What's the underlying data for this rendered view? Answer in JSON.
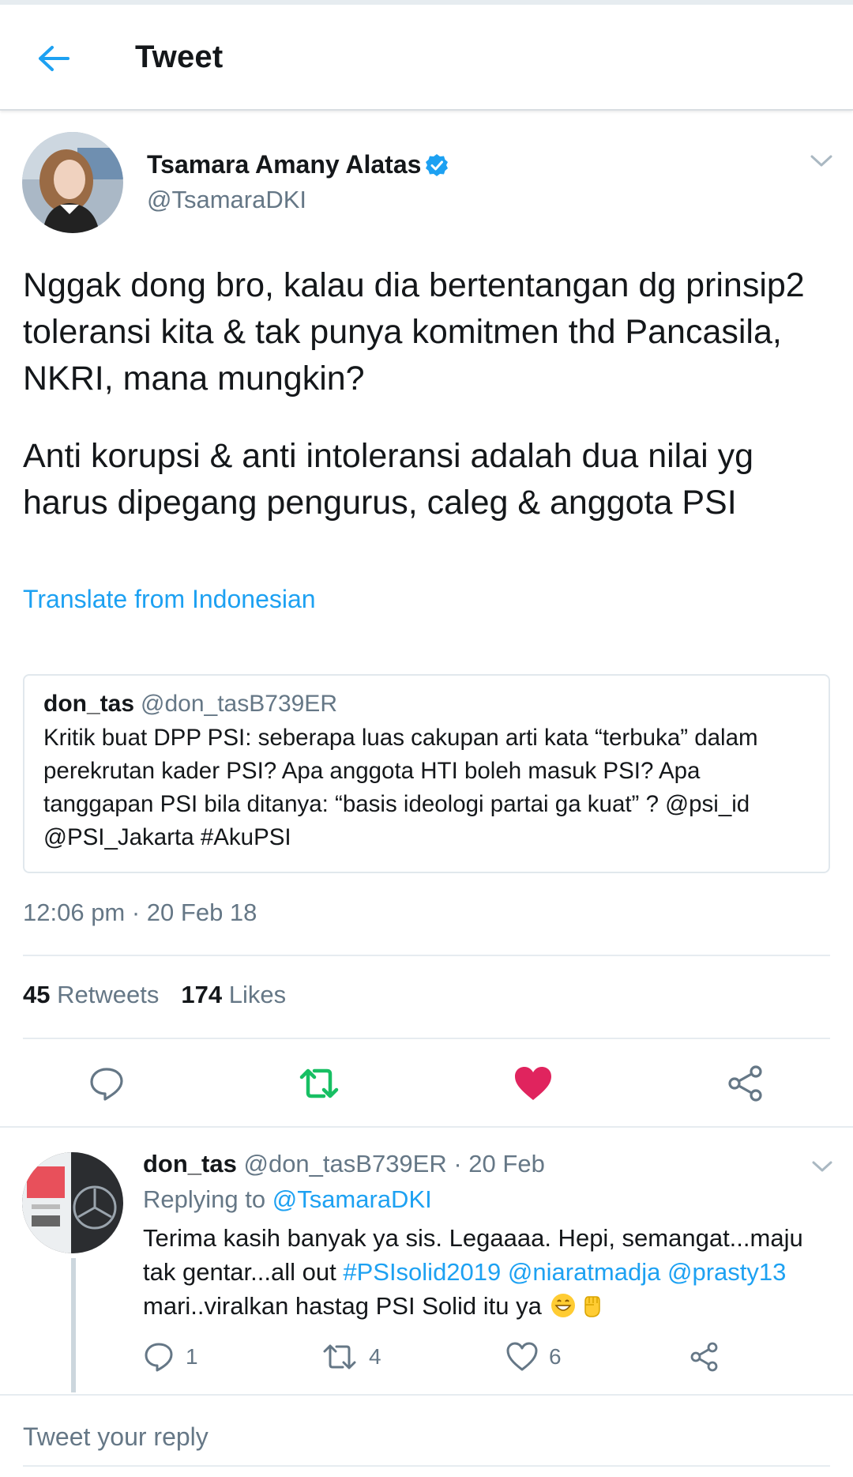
{
  "header": {
    "title": "Tweet",
    "back_icon": "arrow-left-icon",
    "accent_color": "#1da1f2"
  },
  "tweet": {
    "author_name": "Tsamara Amany Alatas",
    "author_handle": "@TsamaraDKI",
    "verified": true,
    "paragraph_1": "Nggak dong bro, kalau dia bertentangan dg prinsip2 toleransi kita & tak punya komitmen thd Pancasila, NKRI, mana mungkin?",
    "paragraph_2": "Anti korupsi & anti intoleransi adalah dua nilai yg harus dipegang pengurus, caleg & anggota PSI",
    "translate_label": "Translate from Indonesian",
    "timestamp": "12:06 pm · 20 Feb 18",
    "retweet_count": "45",
    "retweet_label": "Retweets",
    "like_count": "174",
    "like_label": "Likes",
    "liked": true,
    "liked_color": "#e0245e",
    "retweeted": true,
    "retweeted_color": "#17bf63"
  },
  "quote": {
    "name": "don_tas",
    "handle": "@don_tasB739ER",
    "text": "Kritik buat DPP PSI: seberapa luas cakupan arti kata “terbuka” dalam perekrutan kader PSI? Apa anggota HTI boleh masuk PSI? Apa tanggapan PSI bila ditanya: “basis ideologi partai ga kuat” ? @psi_id @PSI_Jakarta #AkuPSI"
  },
  "reply": {
    "name": "don_tas",
    "handle": "@don_tasB739ER",
    "date": "· 20 Feb",
    "replying_prefix": "Replying to",
    "replying_to": "@TsamaraDKI",
    "text_before": "Terima kasih banyak ya sis. Legaaaa. Hepi, semangat...maju tak gentar...all out",
    "hashtag": "#PSIsolid2019",
    "mention_1": "@niaratmadja",
    "mention_2": "@prasty13",
    "text_after": "mari..viralkan hastag PSI Solid itu ya",
    "emojis": [
      "grinning-face-icon",
      "raised-fist-icon"
    ],
    "reply_count": "1",
    "retweet_count": "4",
    "like_count": "6"
  },
  "compose": {
    "placeholder": "Tweet your reply"
  }
}
